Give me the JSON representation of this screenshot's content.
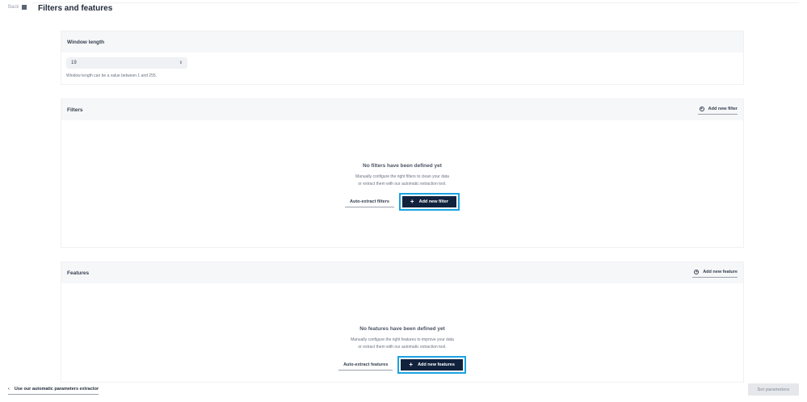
{
  "header": {
    "back_label": "Back",
    "title": "Filters and features"
  },
  "window_length": {
    "title": "Window length",
    "value": "19",
    "helper": "Window length can be a value between 1 and 255."
  },
  "filters": {
    "title": "Filters",
    "add_link": "Add new filter",
    "empty_title": "No filters have been defined yet",
    "empty_line1": "Manually configure the right filters to clean your data",
    "empty_line2": "or extract them with our automatic extraction tool.",
    "auto_extract": "Auto-extract filters",
    "add_button": "Add new filter"
  },
  "features": {
    "title": "Features",
    "add_link": "Add new feature",
    "empty_title": "No features have been defined yet",
    "empty_line1": "Manually configure the right features to improve your data",
    "empty_line2": "or extract them with our automatic extraction tool.",
    "auto_extract": "Auto-extract features",
    "add_button": "Add new features"
  },
  "footer": {
    "extractor_link": "Use our automatic parameters extractor",
    "set_button": "Set parameters"
  },
  "icons": {
    "back": "square-icon",
    "select": "updown-chevron-icon",
    "add_circle": "plus-circle-icon",
    "plus": "plus-icon",
    "chevron_left": "chevron-left-icon"
  },
  "colors": {
    "primary_button": "#11223d",
    "highlight_outline": "#1aa3e0",
    "card_header": "#f6f7f9"
  }
}
